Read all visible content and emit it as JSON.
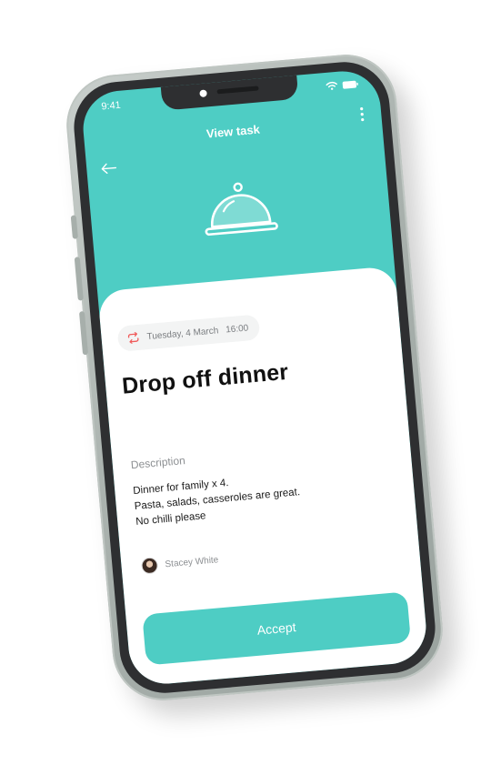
{
  "status_bar": {
    "time": "9:41"
  },
  "header": {
    "title": "View task",
    "back_icon": "arrow-left-icon",
    "more_icon": "more-vertical-icon",
    "hero_icon": "serving-cloche-icon"
  },
  "task": {
    "date": "Tuesday, 4 March",
    "time": "16:00",
    "repeat_icon": "repeat-icon",
    "title": "Drop off dinner",
    "description_label": "Description",
    "description_lines": [
      "Dinner for family x 4.",
      "Pasta, salads, casseroles are great.",
      "No chilli please"
    ],
    "author": "Stacey White"
  },
  "actions": {
    "accept_label": "Accept"
  },
  "colors": {
    "accent": "#4ecdc4",
    "repeat_icon": "#f05a5a",
    "frame": "#2e2f31",
    "phone_shell": "#aab2ae"
  }
}
